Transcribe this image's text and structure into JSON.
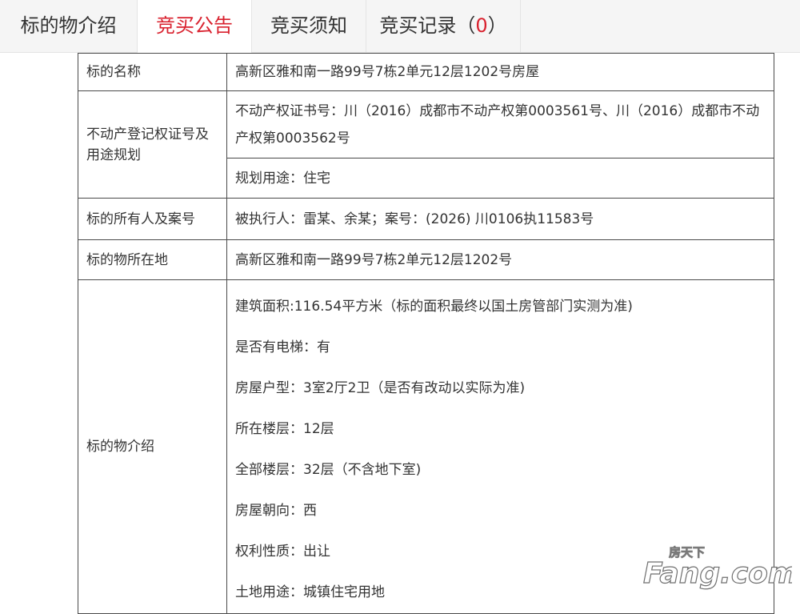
{
  "tabs": [
    {
      "label": "标的物介绍",
      "active": false
    },
    {
      "label": "竞买公告",
      "active": true
    },
    {
      "label": "竞买须知",
      "active": false
    },
    {
      "label": "竞买记录（",
      "count": "0",
      "suffix": "）",
      "active": false
    }
  ],
  "table": {
    "rows": [
      {
        "label": "标的名称",
        "value": "高新区雅和南一路99号7栋2单元12层1202号房屋"
      },
      {
        "label": "不动产登记权证号及用途规划",
        "value": "不动产权证书号：川（2016）成都市不动产权第0003561号、川（2016）成都市不动产权第0003562号"
      },
      {
        "label": "",
        "value": "规划用途：住宅"
      },
      {
        "label": "标的所有人及案号",
        "value": "被执行人：雷某、余某；案号：(2026) 川0106执11583号"
      },
      {
        "label": "标的物所在地",
        "value": "高新区雅和南一路99号7栋2单元12层1202号"
      }
    ],
    "intro": {
      "label": "标的物介绍",
      "items": [
        "建筑面积:116.54平方米（标的面积最终以国土房管部门实测为准)",
        "是否有电梯：有",
        "房屋户型：3室2厅2卫（是否有改动以实际为准)",
        "所在楼层：12层",
        "全部楼层：32层（不含地下室)",
        "房屋朝向：西",
        "权利性质：出让",
        "土地用途：城镇住宅用地"
      ]
    }
  },
  "watermark": {
    "text_cn": "房天下",
    "text_en": "Fang.com"
  }
}
